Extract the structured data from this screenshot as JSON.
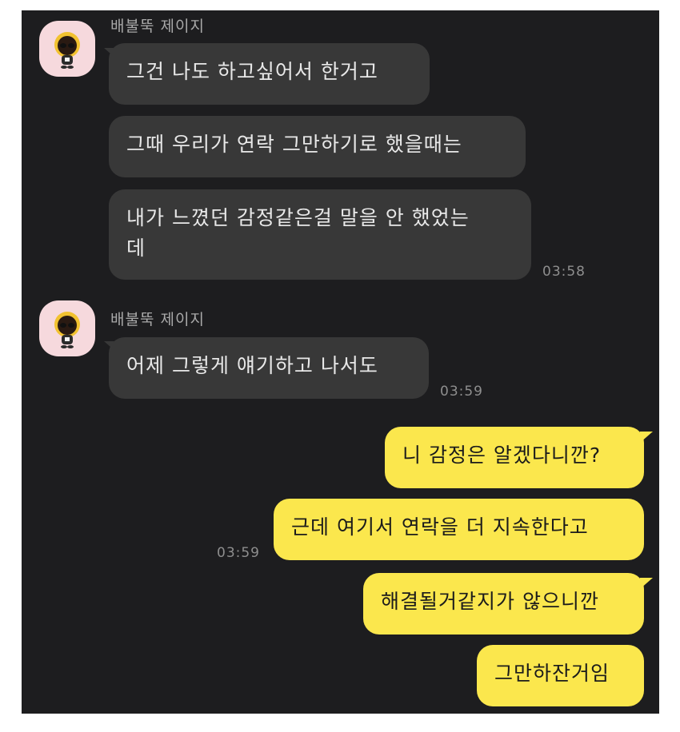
{
  "sender_name": "배불뚝 제이지",
  "group1": {
    "messages": [
      "그건 나도 하고싶어서 한거고",
      "그때 우리가 연락 그만하기로 했을때는",
      "내가 느꼈던 감정같은걸 말을 안 했었는\n데"
    ],
    "time": "03:58"
  },
  "group2": {
    "messages": [
      "어제 그렇게 얘기하고 나서도"
    ],
    "time": "03:59"
  },
  "sent": {
    "messages": [
      "니 감정은 알겠다니깐?",
      "근데 여기서 연락을 더 지속한다고",
      "해결될거같지가 않으니깐",
      "그만하잔거임"
    ],
    "time": "03:59"
  },
  "colors": {
    "background": "#1d1d1f",
    "incoming_bubble": "#383838",
    "outgoing_bubble": "#fbe74d"
  }
}
